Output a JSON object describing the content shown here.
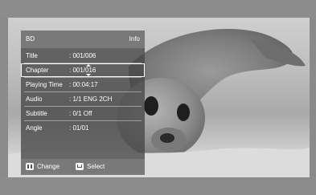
{
  "panel": {
    "header_left": "BD",
    "header_right": "Info",
    "rows": [
      {
        "label": "Title",
        "value": ": 001/006"
      },
      {
        "label": "Chapter",
        "value": ": 001/016"
      },
      {
        "label": "Playing Time",
        "value": ": 00:04:17"
      },
      {
        "label": "Audio",
        "value": ": 1/1 ENG 2CH"
      },
      {
        "label": "Subtitle",
        "value": ": 0/1 Off"
      },
      {
        "label": "Angle",
        "value": ": 01/01"
      }
    ],
    "selected_row_index": 1,
    "footer": {
      "change_label": "Change",
      "select_label": "Select",
      "change_icon": "left-right-icon",
      "select_icon": "enter-icon"
    }
  }
}
